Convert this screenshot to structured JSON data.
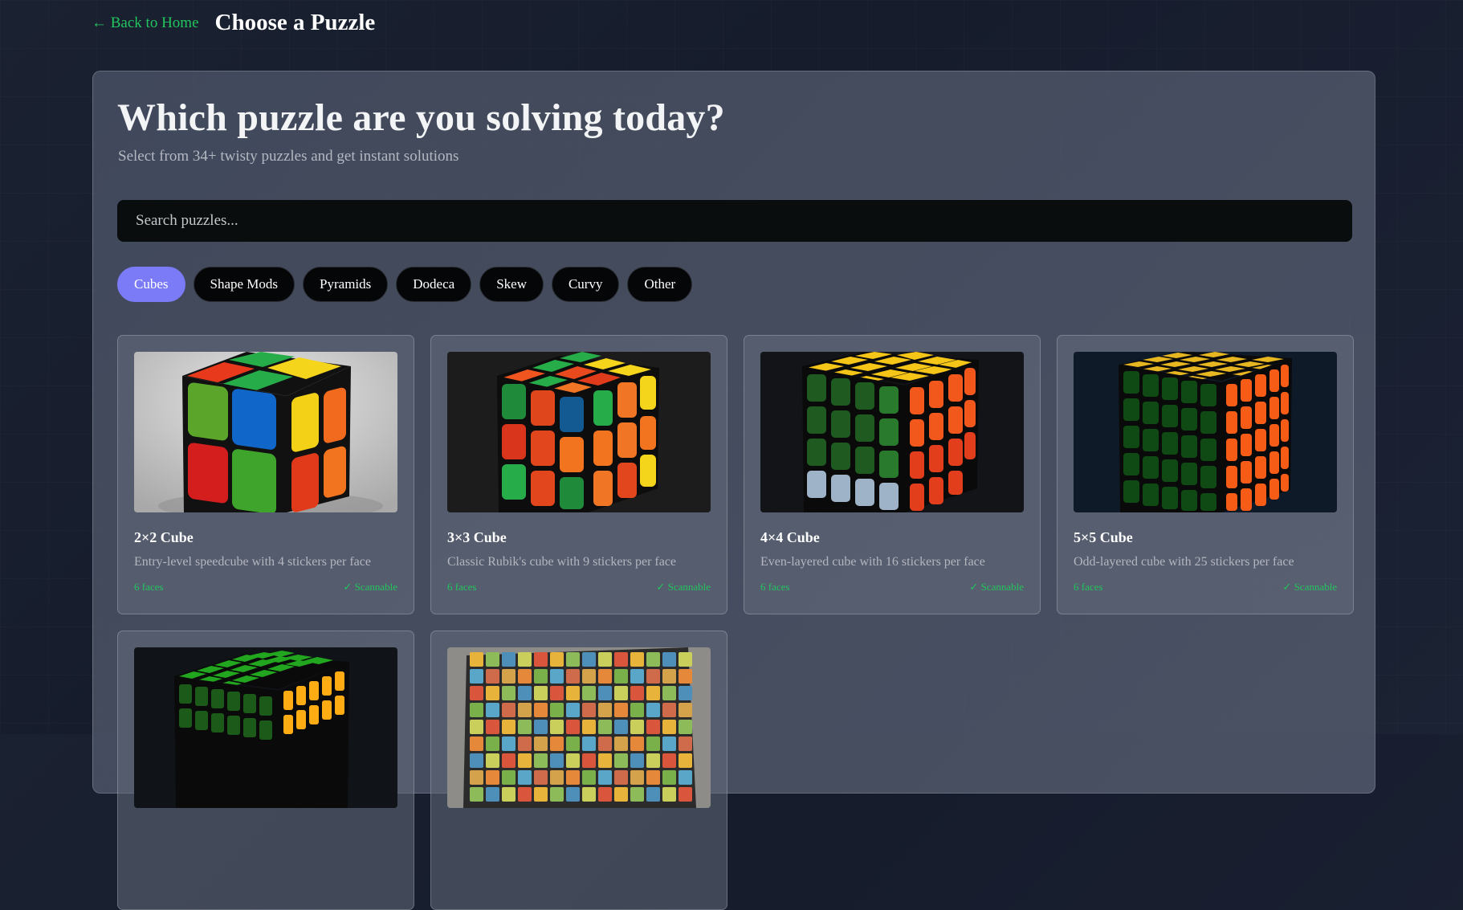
{
  "header": {
    "back_label": "← Back to Home",
    "title": "Choose a Puzzle"
  },
  "main": {
    "heading": "Which puzzle are you solving today?",
    "subtitle": "Select from 34+ twisty puzzles and get instant solutions",
    "search_placeholder": "Search puzzles..."
  },
  "categories": [
    {
      "label": "Cubes",
      "active": true
    },
    {
      "label": "Shape Mods",
      "active": false
    },
    {
      "label": "Pyramids",
      "active": false
    },
    {
      "label": "Dodeca",
      "active": false
    },
    {
      "label": "Skew",
      "active": false
    },
    {
      "label": "Curvy",
      "active": false
    },
    {
      "label": "Other",
      "active": false
    }
  ],
  "puzzles": [
    {
      "title": "2×2 Cube",
      "description": "Entry-level speedcube with 4 stickers per face",
      "faces": "6 faces",
      "scannable": "✓ Scannable"
    },
    {
      "title": "3×3 Cube",
      "description": "Classic Rubik's cube with 9 stickers per face",
      "faces": "6 faces",
      "scannable": "✓ Scannable"
    },
    {
      "title": "4×4 Cube",
      "description": "Even-layered cube with 16 stickers per face",
      "faces": "6 faces",
      "scannable": "✓ Scannable"
    },
    {
      "title": "5×5 Cube",
      "description": "Odd-layered cube with 25 stickers per face",
      "faces": "6 faces",
      "scannable": "✓ Scannable"
    }
  ],
  "colors": {
    "accent_green": "#22c55e",
    "active_chip": "#7b7bf7",
    "chip_bg": "#050607",
    "search_bg": "#0a0d0d"
  }
}
